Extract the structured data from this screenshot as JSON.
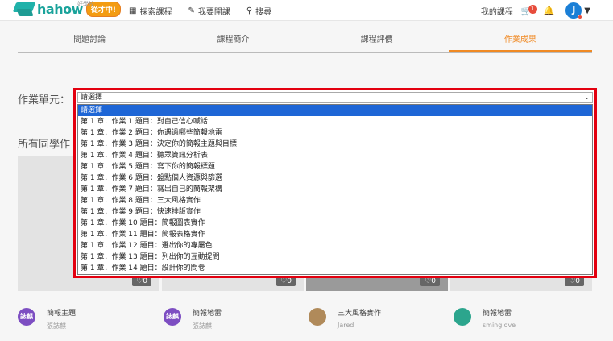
{
  "header": {
    "logo_text": "hahow",
    "logo_sub": "好學校",
    "logo_badge": "從才中!",
    "nav": [
      {
        "icon": "grid-icon",
        "glyph": "▦",
        "label": "探索課程"
      },
      {
        "icon": "pencil-icon",
        "glyph": "✎",
        "label": "我要開課"
      },
      {
        "icon": "search-icon",
        "glyph": "⚲",
        "label": "搜尋"
      }
    ],
    "my_courses": "我的課程",
    "cart_count": "1",
    "avatar_letter": "J"
  },
  "tabs": [
    {
      "label": "問題討論",
      "active": false
    },
    {
      "label": "課程簡介",
      "active": false
    },
    {
      "label": "課程評價",
      "active": false
    },
    {
      "label": "作業成果",
      "active": true
    }
  ],
  "unit_label": "作業單元：",
  "all_label": "所有同學作",
  "select": {
    "value": "請選擇",
    "options": [
      "請選擇",
      "第 1 章．作業 1 題目：對自己信心喊話",
      "第 1 章．作業 2 題目：你遇過哪些簡報地雷",
      "第 1 章．作業 3 題目：決定你的簡報主題與目標",
      "第 1 章．作業 4 題目：聽眾資訊分析表",
      "第 1 章．作業 5 題目：寫下你的簡報標題",
      "第 1 章．作業 6 題目：盤點個人資源與篩選",
      "第 1 章．作業 7 題目：寫出自己的簡報架構",
      "第 1 章．作業 8 題目：三大風格實作",
      "第 1 章．作業 9 題目：快速排版實作",
      "第 1 章．作業 10 題目：簡報圖表實作",
      "第 1 章．作業 11 題目：簡報表格實作",
      "第 1 章．作業 12 題目：選出你的專屬色",
      "第 1 章．作業 13 題目：列出你的互動提問",
      "第 1 章．作業 14 題目：設計你的問卷"
    ]
  },
  "cards": [
    {
      "likes": "♡0"
    },
    {
      "likes": "♡0"
    },
    {
      "likes": "♡0"
    },
    {
      "likes": "♡0"
    }
  ],
  "authors": [
    {
      "avatar": "誌麒",
      "color": "#7d4ec2",
      "title": "簡報主題",
      "name": "張誌麒"
    },
    {
      "avatar": "誌麒",
      "color": "#7d4ec2",
      "title": "簡報地雷",
      "name": "張誌麒"
    },
    {
      "avatar": "",
      "color": "#b08a5a",
      "title": "三大風格實作",
      "name": "Jared"
    },
    {
      "avatar": "",
      "color": "#2ca58d",
      "title": "簡報地雷",
      "name": "sminglove"
    }
  ]
}
